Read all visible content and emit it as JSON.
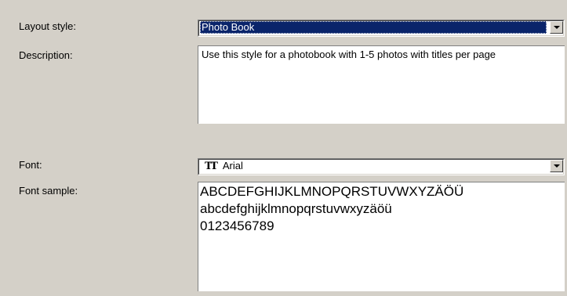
{
  "layout_style": {
    "label": "Layout style:",
    "value": "Photo Book"
  },
  "description": {
    "label": "Description:",
    "text": "Use this style for a photobook with 1-5 photos with titles per page"
  },
  "font": {
    "label": "Font:",
    "icon": "truetype-font-icon",
    "icon_glyph": "TT",
    "value": "Arial"
  },
  "font_sample": {
    "label": "Font sample:",
    "lines": [
      "ABCDEFGHIJKLMNOPQRSTUVWXYZÄÖÜ",
      "abcdefghijklmnopqrstuvwxyzäöü",
      "0123456789"
    ]
  },
  "colors": {
    "background": "#d4d0c8",
    "selection": "#0a246a"
  }
}
